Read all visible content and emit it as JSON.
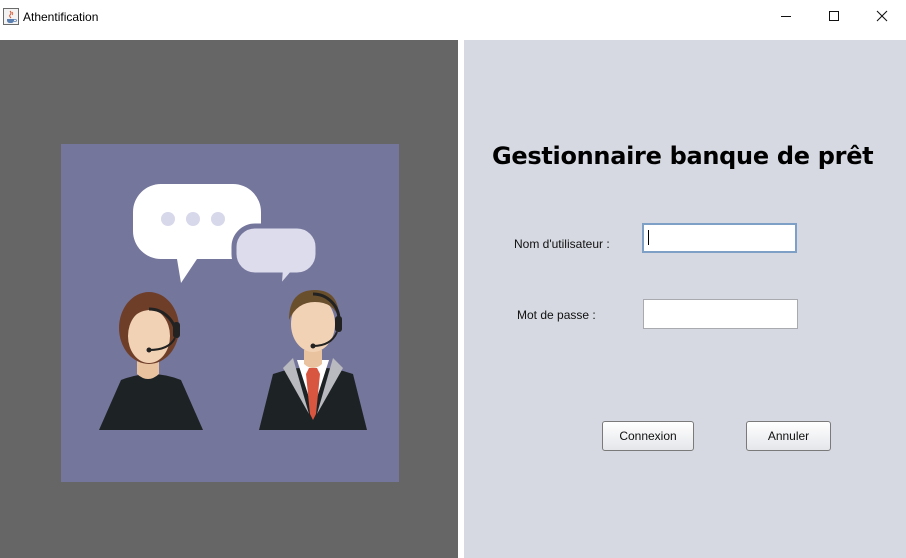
{
  "window": {
    "title": "Athentification",
    "icon": "java-cup-icon",
    "controls": [
      "minimize-icon",
      "maximize-icon",
      "close-icon"
    ]
  },
  "illustration": {
    "description_icon": "support-agents-illustration",
    "background_color": "#75769c"
  },
  "form": {
    "heading": "Gestionnaire banque de prêt",
    "username_label": "Nom d'utilisateur :",
    "username_value": "",
    "password_label": "Mot de passe :",
    "password_value": "",
    "connect_button": "Connexion",
    "cancel_button": "Annuler"
  },
  "colors": {
    "left_pane": "#666666",
    "right_pane": "#d6d9e1"
  }
}
